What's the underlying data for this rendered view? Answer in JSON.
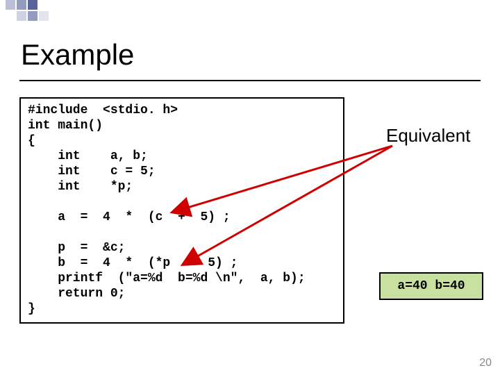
{
  "title": "Example",
  "code_text": "#include  <stdio. h>\nint main()\n{\n    int    a, b;\n    int    c = 5;\n    int    *p;\n\n    a  =  4  *  (c  +  5) ;\n\n    p  =  &c;\n    b  =  4  *  (*p  +  5) ;\n    printf  (\"a=%d  b=%d \\n\",  a, b);\n    return 0;\n}",
  "equivalent_label": "Equivalent",
  "output_text": "a=40 b=40",
  "page_number": "20"
}
